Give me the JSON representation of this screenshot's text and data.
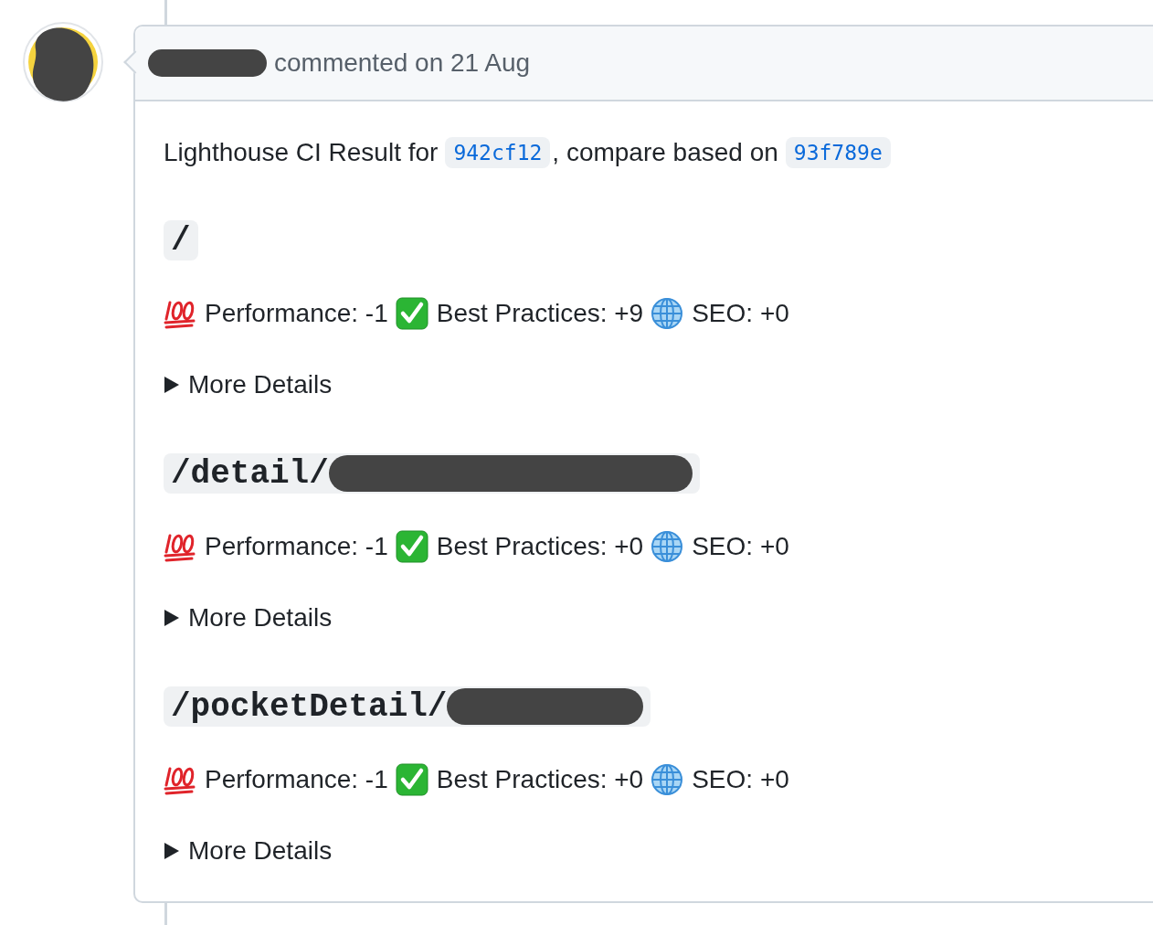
{
  "comment": {
    "header": {
      "author_redacted": true,
      "action": "commented on 21 Aug"
    },
    "intro": {
      "text": "Lighthouse CI Result for",
      "commit": "942cf12",
      "middle": ", compare based on",
      "base": "93f789e"
    },
    "sections": [
      {
        "path": "/",
        "redacted": false,
        "expanded": false,
        "details_label": "More Details",
        "metrics": [
          {
            "kind": "performance",
            "label": "Performance: -1"
          },
          {
            "kind": "best_practices",
            "label": "Best Practices: +9"
          },
          {
            "kind": "seo",
            "label": "SEO: +0"
          }
        ]
      },
      {
        "path": "/detail/",
        "redacted": true,
        "expanded": false,
        "details_label": "More Details",
        "metrics": [
          {
            "kind": "performance",
            "label": "Performance: -1"
          },
          {
            "kind": "best_practices",
            "label": "Best Practices: +0"
          },
          {
            "kind": "seo",
            "label": "SEO: +0"
          }
        ]
      },
      {
        "path": "/pocketDetail/",
        "redacted": true,
        "expanded": false,
        "details_label": "More Details",
        "metrics": [
          {
            "kind": "performance",
            "label": "Performance: -1"
          },
          {
            "kind": "best_practices",
            "label": "Best Practices: +0"
          },
          {
            "kind": "seo",
            "label": "SEO: +0"
          }
        ]
      }
    ]
  }
}
